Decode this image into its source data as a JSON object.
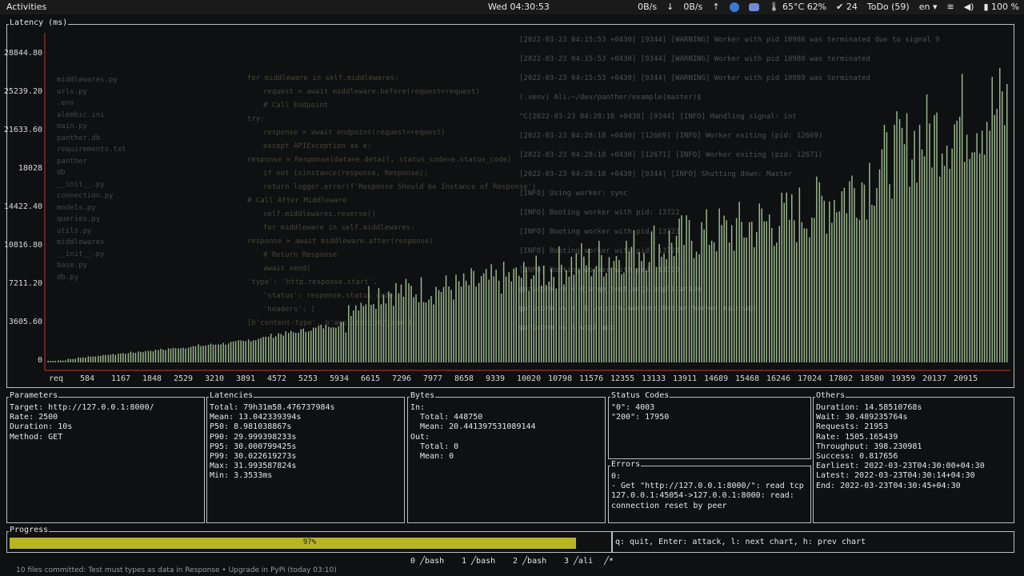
{
  "topbar": {
    "activities": "Activities",
    "clock": "Wed 04:30:53",
    "net_down1": "0B/s",
    "net_up1": "0B/s",
    "temp": "65°C 62%",
    "updates": "24",
    "todo": "ToDo (59)",
    "lang": "en",
    "battery": "100 %"
  },
  "chart": {
    "title": "Latency (ms)",
    "y_ticks": [
      "28844.80",
      "25239.20",
      "21633.60",
      "18028",
      "14422.40",
      "10816.80",
      "7211.20",
      "3605.60",
      "0"
    ],
    "x_ticks": [
      "req",
      "584",
      "1167",
      "1848",
      "2529",
      "3210",
      "3891",
      "4572",
      "5253",
      "5934",
      "6615",
      "7296",
      "7977",
      "8658",
      "9339",
      "10020",
      "10798",
      "11576",
      "12355",
      "13133",
      "13911",
      "14689",
      "15468",
      "16246",
      "17024",
      "17802",
      "18580",
      "19359",
      "20137",
      "20915"
    ],
    "bar_color": "#a8c898"
  },
  "chart_data": {
    "type": "bar",
    "title": "Latency (ms)",
    "xlabel": "",
    "ylabel": "",
    "ylim": [
      0,
      28844.8
    ],
    "x_range": [
      0,
      21953
    ],
    "values_ms": [
      120,
      200,
      350,
      500,
      600,
      700,
      800,
      900,
      1000,
      1100,
      1200,
      1300,
      1400,
      1500,
      1600,
      1700,
      1800,
      1900,
      2000,
      2100,
      2300,
      2500,
      2700,
      2900,
      3000,
      3200,
      3400,
      3600,
      3800,
      4000,
      6500,
      7200,
      7700,
      8000,
      8100,
      8000,
      8200,
      8300,
      8200,
      8400,
      8500,
      8600,
      8900,
      9000,
      9200,
      9500,
      9600,
      9800,
      10000,
      10200,
      10500,
      11000,
      11200,
      11500,
      11300,
      11800,
      12000,
      12500,
      12800,
      13000,
      13500,
      13200,
      13600,
      14000,
      14300,
      14500,
      14700,
      14800,
      15000,
      15200,
      15500,
      15800,
      16000,
      16300,
      16500,
      17000,
      17500,
      18000,
      18500,
      19200,
      19800,
      20500,
      21500,
      22500,
      23500,
      24000,
      25000,
      25500,
      26000,
      26500,
      27000,
      27500,
      28000,
      28300,
      28500,
      28600
    ]
  },
  "panels": {
    "parameters": {
      "title": "Parameters",
      "body": "Target: http://127.0.0.1:8000/\nRate: 2500\nDuration: 10s\nMethod: GET"
    },
    "latencies": {
      "title": "Latencies",
      "body": "Total: 79h31m58.476737984s\nMean: 13.042339394s\nP50: 8.981038867s\nP90: 29.999398233s\nP95: 30.000799425s\nP99: 30.022619273s\nMax: 31.993587824s\nMin: 3.3533ms"
    },
    "bytes": {
      "title": "Bytes",
      "body": "In:\n  Total: 448750\n  Mean: 20.441397531089144\nOut:\n  Total: 0\n  Mean: 0"
    },
    "status_codes": {
      "title": "Status Codes",
      "body": "\"0\": 4003\n\"200\": 17950"
    },
    "errors": {
      "title": "Errors",
      "body": "0:\n- Get \"http://127.0.0.1:8000/\": read tcp\n127.0.0.1:45054->127.0.0.1:8000: read:\nconnection reset by peer"
    },
    "others": {
      "title": "Others",
      "body": "Duration: 14.58510768s\nWait: 30.489235764s\nRequests: 21953\nRate: 1505.165439\nThroughput: 398.230981\nSuccess: 0.817656\nEarliest: 2022-03-23T04:30:00+04:30\nLatest: 2022-03-23T04:30:14+04:30\nEnd: 2022-03-23T04:30:45+04:30"
    }
  },
  "progress": {
    "title": "Progress",
    "percent_text": "97%",
    "value": 97,
    "color": "#b8b525"
  },
  "help": {
    "text": "q: quit, Enter: attack, l: next chart, h: prev chart"
  },
  "tmux": {
    "windows": [
      "0 ╱bash",
      "1 ╱bash",
      "2 ╱bash",
      "3 ╱ali",
      "╱*"
    ]
  },
  "statusline": {
    "text": "10 files committed: Test must types as data in Response • Upgrade in PyPi (today 03:10)"
  },
  "ghost": {
    "editor_lines": [
      "for middleware in self.middlewares:",
      "request = await middleware.before(request=request)",
      "# Call Endpoint",
      "try:",
      "response = await endpoint(request=request)",
      "except APIException as e:",
      "response = Response(data=e.detail, status_code=e.status_code)",
      "if not isinstance(response, Response):",
      "return logger.error(f'Response Should be Instance of Response')",
      "# Call After Middleware",
      "self.middlewares.reverse()",
      "for middleware in self.middlewares:",
      "response = await middleware.after(response)",
      "# Return Response",
      "await send(",
      "'type': 'http.response.start',",
      "'status': response.status_code,",
      "'headers': [",
      "[b'content-type', b'application/json'],"
    ],
    "files": [
      "middlewares.py",
      "urls.py",
      ".env",
      "alembic.ini",
      "main.py",
      "panther.db",
      "requirements.txt",
      "panther",
      "db",
      "__init__.py",
      "connection.py",
      "models.py",
      "queries.py",
      "utils.py",
      "middlewares",
      "__init__.py",
      "base.py",
      "db.py"
    ],
    "term_lines": [
      "[2022-03-23 04:15:53 +0430] [9344] [WARNING] Worker with pid 10986 was terminated due to signal 9",
      "[2022-03-23 04:15:53 +0430] [9344] [WARNING] Worker with pid 10988 was terminated",
      "[2022-03-23 04:15:53 +0430] [9344] [WARNING] Worker with pid 10989 was terminated",
      "(.venv) Ali:~/dev/panther/example(master)$",
      "^C[2022-03-23 04:28:18 +0430] [9344] [INFO] Handling signal: int",
      "[2022-03-23 04:28:18 +0430] [12669] [INFO] Worker exiting (pid: 12669)",
      "[2022-03-23 04:28:18 +0430] [12671] [INFO] Worker exiting (pid: 12671)",
      "[2022-03-23 04:28:18 +0430] [9344] [INFO] Shutting down: Master",
      "[INFO] Using worker: sync",
      "[INFO] Booting worker with pid: 13722",
      "[INFO] Booting worker with pid: 13723",
      "[INFO] Booting worker with pid: 13724",
      "[INFO] Booting worker with pid: 13725",
      "gunicorn -w 4 django_test.wsgi:application",
      "gunicorn -w 4 -k uvicorn.workers.UvicornWorker main:app",
      "gunicorn -w 4 wsgi:app"
    ]
  }
}
